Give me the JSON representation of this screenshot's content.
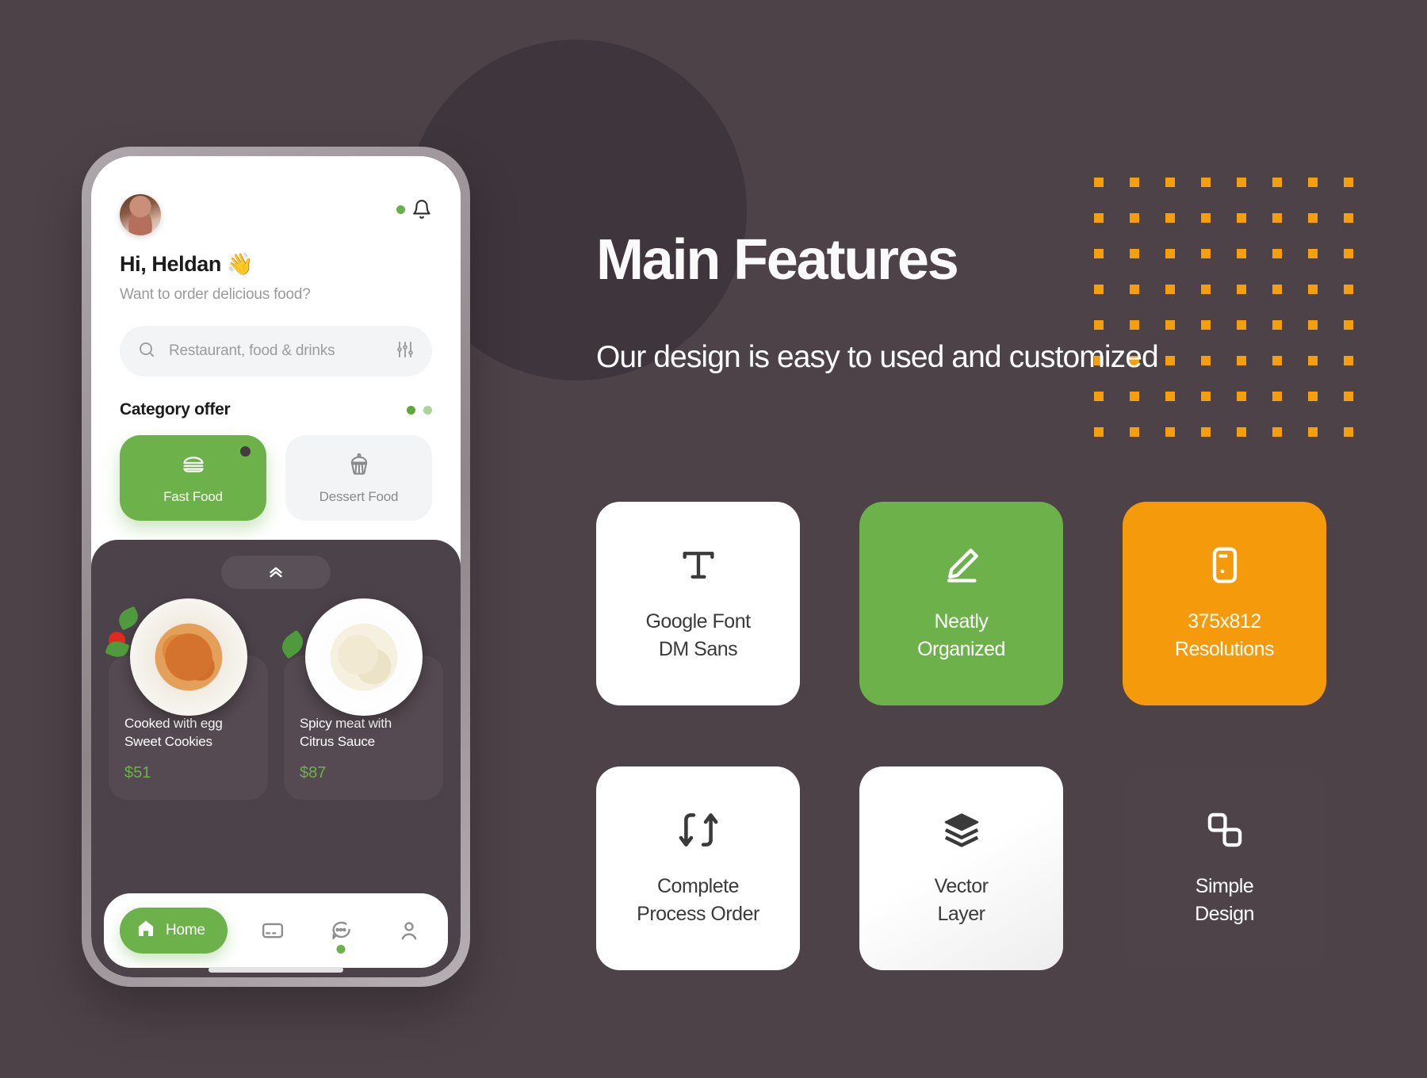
{
  "background": {
    "page_color": "#4E4249",
    "circle_color": "#3F363D",
    "dot_color": "#F79E0B",
    "dot_rows": 8,
    "dot_cols": 8
  },
  "phone": {
    "header": {
      "avatar": "user-avatar",
      "notification_icon": "bell-icon",
      "notification_dot_color": "#6AB04C",
      "greeting": "Hi, Heldan",
      "greeting_emoji": "👋",
      "subtitle": "Want to order delicious food?"
    },
    "search": {
      "icon": "search-icon",
      "placeholder": "Restaurant, food & drinks",
      "filter_icon": "sliders-icon"
    },
    "category": {
      "title": "Category offer",
      "dots": [
        "#5FA83C",
        "#AED49A"
      ],
      "items": [
        {
          "label": "Fast Food",
          "icon": "burger-icon",
          "active": true,
          "badge": true
        },
        {
          "label": "Dessert Food",
          "icon": "cupcake-icon",
          "active": false,
          "badge": false
        }
      ]
    },
    "panel": {
      "pull_handle_icon": "chevrons-up-icon",
      "foods": [
        {
          "name": "Cooked with egg\nSweet Cookies",
          "name_line1": "Cooked with egg",
          "name_line2": "Sweet Cookies",
          "price": "$51",
          "image": "pasta-bowl-photo"
        },
        {
          "name": "Spicy meat with\nCitrus Sauce",
          "name_line1": "Spicy meat with",
          "name_line2": "Citrus Sauce",
          "price": "$87",
          "image": "tortellini-bowl-photo"
        }
      ]
    },
    "bottom_nav": [
      {
        "label": "Home",
        "icon": "home-icon",
        "active": true,
        "dot": false
      },
      {
        "label": "",
        "icon": "card-icon",
        "active": false,
        "dot": false
      },
      {
        "label": "",
        "icon": "chat-bubble-icon",
        "active": false,
        "dot": true
      },
      {
        "label": "",
        "icon": "person-icon",
        "active": false,
        "dot": false
      }
    ]
  },
  "content": {
    "title": "Main Features",
    "subtitle": "Our design is easy to used and customized",
    "cards": [
      {
        "line1": "Google Font",
        "line2": "DM Sans",
        "icon": "text-type-icon",
        "style": "white",
        "color": "#FFFFFF"
      },
      {
        "line1": "Neatly",
        "line2": "Organized",
        "icon": "pencil-edit-icon",
        "style": "green",
        "color": "#6DB14A"
      },
      {
        "line1": "375x812",
        "line2": "Resolutions",
        "icon": "mobile-device-icon",
        "style": "orange",
        "color": "#F59B0B"
      },
      {
        "line1": "Complete",
        "line2": "Process Order",
        "icon": "transfer-arrows-icon",
        "style": "white",
        "color": "#FFFFFF"
      },
      {
        "line1": "Vector",
        "line2": "Layer",
        "icon": "layers-icon",
        "style": "gradwhite",
        "color": "#FFFFFF"
      },
      {
        "line1": "Simple",
        "line2": "Design",
        "icon": "copy-shapes-icon",
        "style": "dark",
        "color": "#4E4349"
      }
    ]
  }
}
